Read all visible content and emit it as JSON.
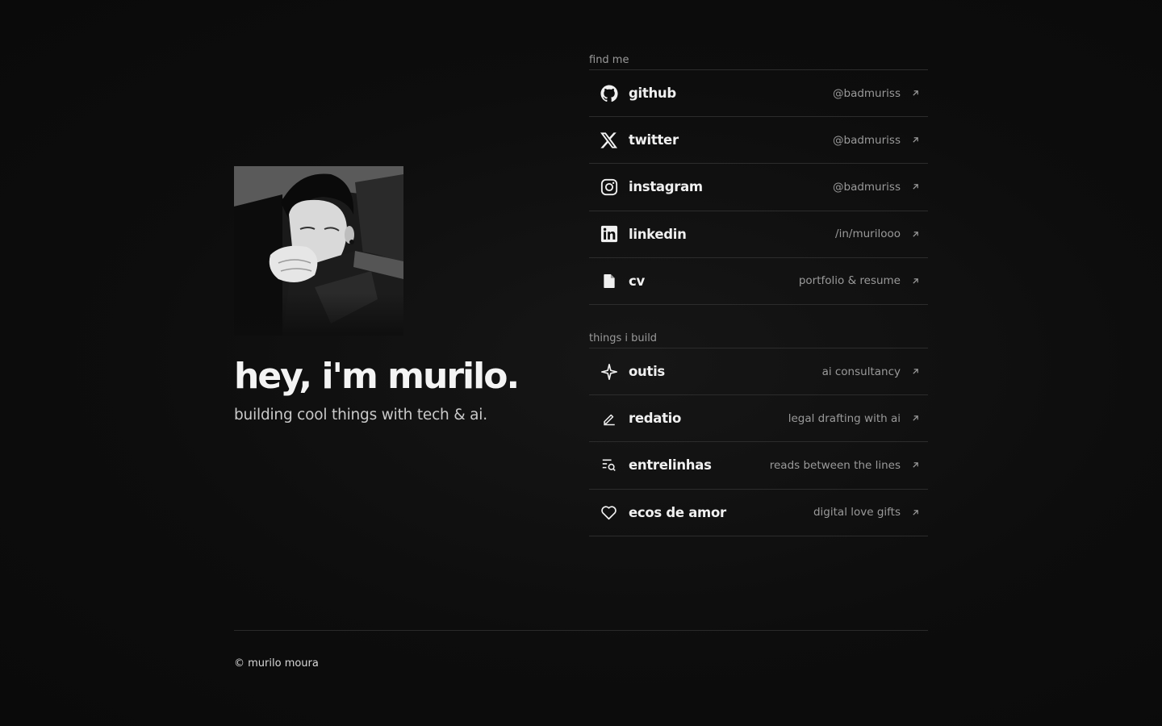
{
  "profile": {
    "title": "hey, i'm murilo.",
    "subtitle": "building cool things with tech & ai."
  },
  "find_me": {
    "label": "find me",
    "items": [
      {
        "name": "github",
        "meta": "@badmuriss",
        "icon": "github-icon"
      },
      {
        "name": "twitter",
        "meta": "@badmuriss",
        "icon": "x-icon"
      },
      {
        "name": "instagram",
        "meta": "@badmuriss",
        "icon": "instagram-icon"
      },
      {
        "name": "linkedin",
        "meta": "/in/murilooo",
        "icon": "linkedin-icon"
      },
      {
        "name": "cv",
        "meta": "portfolio & resume",
        "icon": "file-icon"
      }
    ]
  },
  "build": {
    "label": "things i build",
    "items": [
      {
        "name": "outis",
        "meta": "ai consultancy",
        "icon": "sparkle-icon"
      },
      {
        "name": "redatio",
        "meta": "legal drafting with ai",
        "icon": "pen-icon"
      },
      {
        "name": "entrelinhas",
        "meta": "reads between the lines",
        "icon": "text-search-icon"
      },
      {
        "name": "ecos de amor",
        "meta": "digital love gifts",
        "icon": "heart-icon"
      }
    ]
  },
  "footer": {
    "text": "© murilo moura"
  },
  "colors": {
    "background": "#0d0d0d",
    "text": "#f2f2f2",
    "muted": "#9a9a9a",
    "divider": "#2c2c2c"
  }
}
